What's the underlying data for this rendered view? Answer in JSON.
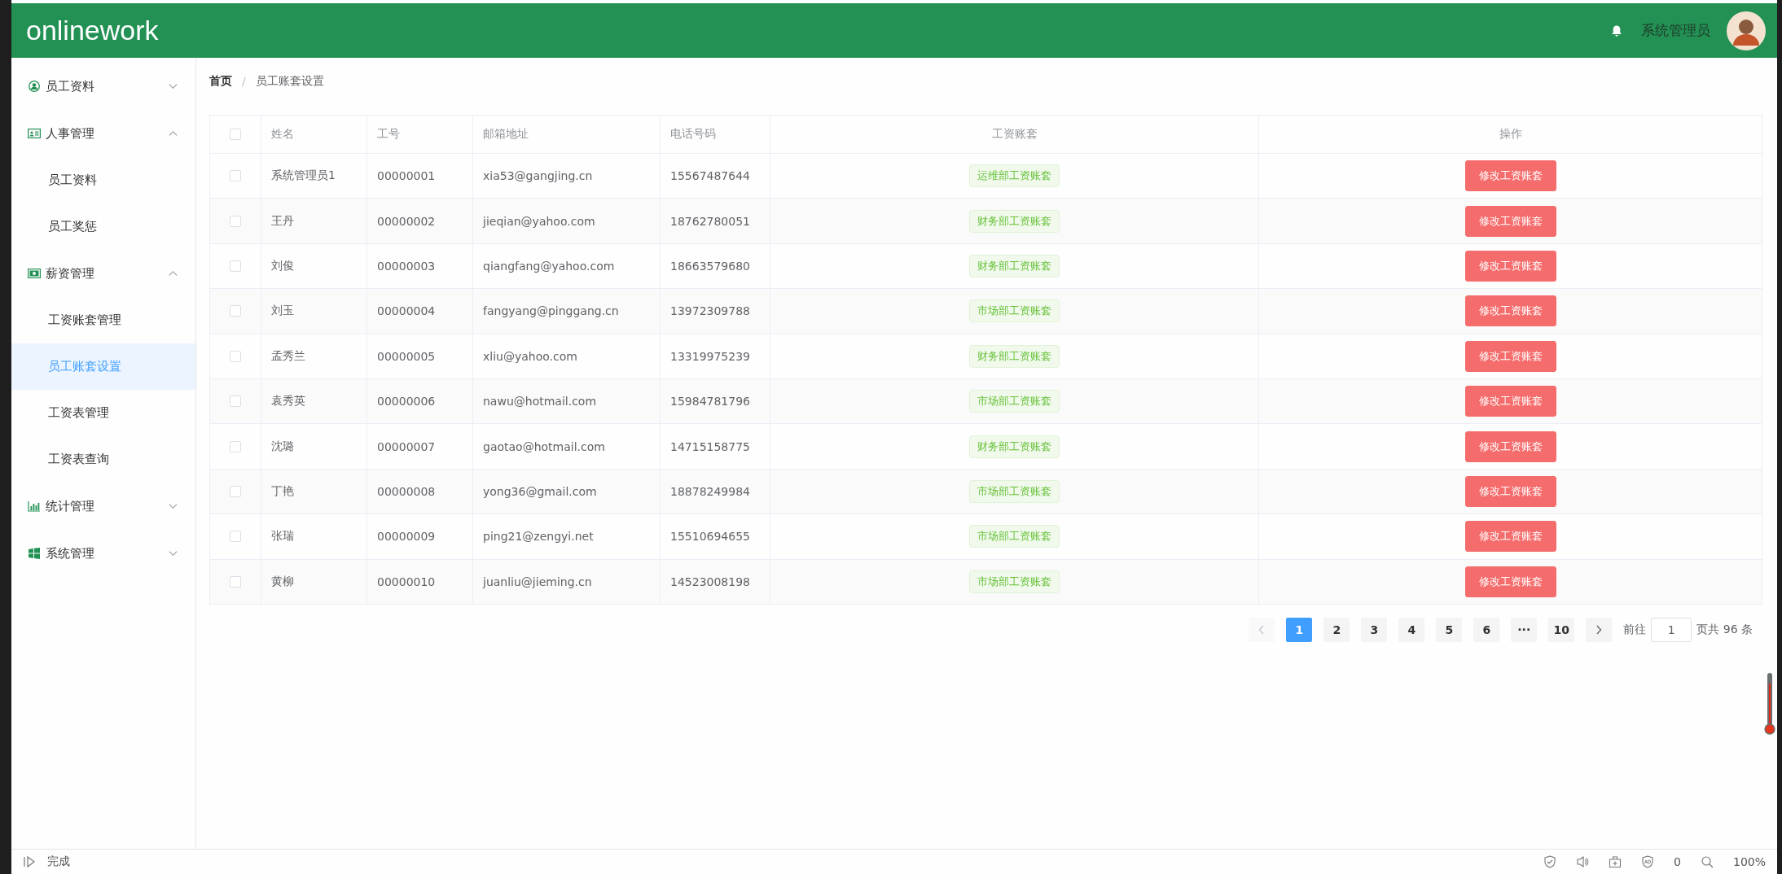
{
  "header": {
    "logo": "onlinework",
    "username": "系统管理员"
  },
  "sidebar": {
    "items": [
      {
        "label": "员工资料",
        "expanded": false
      },
      {
        "label": "人事管理",
        "expanded": true,
        "children": [
          {
            "label": "员工资料",
            "selected": false
          },
          {
            "label": "员工奖惩",
            "selected": false
          }
        ]
      },
      {
        "label": "薪资管理",
        "expanded": true,
        "children": [
          {
            "label": "工资账套管理",
            "selected": false
          },
          {
            "label": "员工账套设置",
            "selected": true
          },
          {
            "label": "工资表管理",
            "selected": false
          },
          {
            "label": "工资表查询",
            "selected": false
          }
        ]
      },
      {
        "label": "统计管理",
        "expanded": false
      },
      {
        "label": "系统管理",
        "expanded": false
      }
    ]
  },
  "breadcrumb": {
    "separator": "/",
    "items": [
      {
        "label": "首页",
        "current": false
      },
      {
        "label": "员工账套设置",
        "current": true
      }
    ]
  },
  "table": {
    "all_checked": false,
    "columns": [
      "姓名",
      "工号",
      "邮箱地址",
      "电话号码",
      "工资账套",
      "操作"
    ],
    "rows": [
      {
        "checked": false,
        "name": "系统管理员1",
        "number": "00000001",
        "email": "xia53@gangjing.cn",
        "phone": "15567487644",
        "salary_set": "运维部工资账套",
        "action": "修改工资账套"
      },
      {
        "checked": false,
        "name": "王丹",
        "number": "00000002",
        "email": "jieqian@yahoo.com",
        "phone": "18762780051",
        "salary_set": "财务部工资账套",
        "action": "修改工资账套"
      },
      {
        "checked": false,
        "name": "刘俊",
        "number": "00000003",
        "email": "qiangfang@yahoo.com",
        "phone": "18663579680",
        "salary_set": "财务部工资账套",
        "action": "修改工资账套"
      },
      {
        "checked": false,
        "name": "刘玉",
        "number": "00000004",
        "email": "fangyang@pinggang.cn",
        "phone": "13972309788",
        "salary_set": "市场部工资账套",
        "action": "修改工资账套"
      },
      {
        "checked": false,
        "name": "孟秀兰",
        "number": "00000005",
        "email": "xliu@yahoo.com",
        "phone": "13319975239",
        "salary_set": "财务部工资账套",
        "action": "修改工资账套"
      },
      {
        "checked": false,
        "name": "袁秀英",
        "number": "00000006",
        "email": "nawu@hotmail.com",
        "phone": "15984781796",
        "salary_set": "市场部工资账套",
        "action": "修改工资账套"
      },
      {
        "checked": false,
        "name": "沈璐",
        "number": "00000007",
        "email": "gaotao@hotmail.com",
        "phone": "14715158775",
        "salary_set": "财务部工资账套",
        "action": "修改工资账套"
      },
      {
        "checked": false,
        "name": "丁艳",
        "number": "00000008",
        "email": "yong36@gmail.com",
        "phone": "18878249984",
        "salary_set": "市场部工资账套",
        "action": "修改工资账套"
      },
      {
        "checked": false,
        "name": "张瑞",
        "number": "00000009",
        "email": "ping21@zengyi.net",
        "phone": "15510694655",
        "salary_set": "市场部工资账套",
        "action": "修改工资账套"
      },
      {
        "checked": false,
        "name": "黄柳",
        "number": "00000010",
        "email": "juanliu@jieming.cn",
        "phone": "14523008198",
        "salary_set": "市场部工资账套",
        "action": "修改工资账套"
      }
    ]
  },
  "pagination": {
    "pages": [
      {
        "kind": "prev",
        "disabled": true
      },
      {
        "kind": "page",
        "label": "1",
        "selected": true
      },
      {
        "kind": "page",
        "label": "2",
        "selected": false
      },
      {
        "kind": "page",
        "label": "3",
        "selected": false
      },
      {
        "kind": "page",
        "label": "4",
        "selected": false
      },
      {
        "kind": "page",
        "label": "5",
        "selected": false
      },
      {
        "kind": "page",
        "label": "6",
        "selected": false
      },
      {
        "kind": "more",
        "label": "···",
        "selected": false
      },
      {
        "kind": "page",
        "label": "10",
        "selected": false
      },
      {
        "kind": "next",
        "disabled": false
      }
    ],
    "goto_label": "前往",
    "goto_value": "1",
    "total": "页共 96 条"
  },
  "status_bar": {
    "status": "完成",
    "count": "0",
    "zoom": "100%"
  }
}
